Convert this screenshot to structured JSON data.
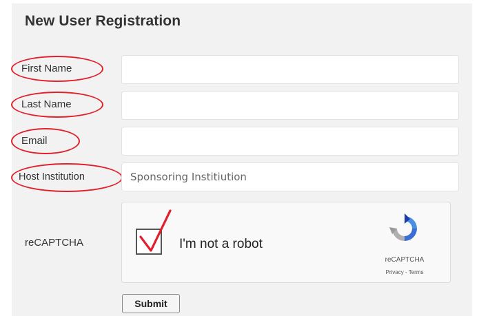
{
  "form": {
    "title": "New User Registration",
    "fields": [
      {
        "label": "First Name",
        "value": "",
        "placeholder": ""
      },
      {
        "label": "Last Name",
        "value": "",
        "placeholder": ""
      },
      {
        "label": "Email",
        "value": "",
        "placeholder": ""
      },
      {
        "label": "Host Institution",
        "value": "",
        "placeholder": "Sponsoring Institiution"
      }
    ],
    "recaptcha_label": "reCAPTCHA",
    "submit_label": "Submit"
  },
  "recaptcha": {
    "checkbox_text": "I'm not a robot",
    "checked": true,
    "brand": "reCAPTCHA",
    "links": "Privacy - Terms"
  },
  "colors": {
    "highlight": "#e0202c",
    "panel_bg": "#f2f2f2",
    "recaptcha_blue": "#4a90e2",
    "recaptcha_grey": "#b0b0b0"
  },
  "icons": {
    "checkmark": "checkmark-icon",
    "recaptcha_logo": "recaptcha-logo-icon"
  }
}
